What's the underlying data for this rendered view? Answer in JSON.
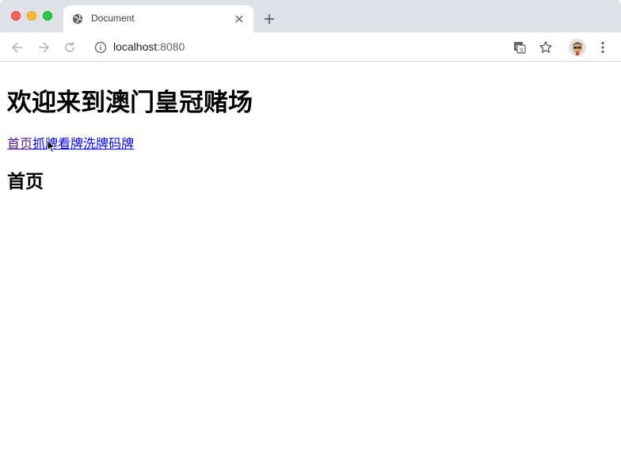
{
  "browser": {
    "tab": {
      "title": "Document",
      "icon": "globe-icon"
    },
    "address": {
      "host": "localhost",
      "port": ":8080"
    },
    "colors": {
      "tabstrip": "#dee1e6",
      "link": "#0000ee",
      "visited": "#551a8b"
    }
  },
  "page": {
    "heading": "欢迎来到澳门皇冠赌场",
    "nav": [
      {
        "label": "首页",
        "state": "visited"
      },
      {
        "label": "抓牌",
        "state": "link"
      },
      {
        "label": "看牌",
        "state": "link"
      },
      {
        "label": "洗牌",
        "state": "link"
      },
      {
        "label": "码牌",
        "state": "link"
      }
    ],
    "subheading": "首页"
  }
}
